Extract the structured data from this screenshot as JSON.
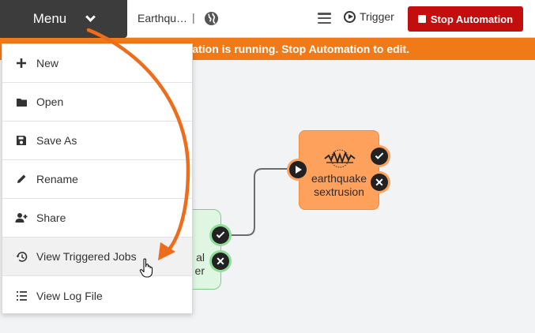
{
  "topbar": {
    "menu_label": "Menu",
    "doc_title": "Earthqu…",
    "separator": "|",
    "trigger_label": "Trigger",
    "stop_label": "Stop Automation"
  },
  "banner": {
    "text": "Automation is running. Stop Automation to edit."
  },
  "menu": {
    "items": [
      {
        "label": "New",
        "icon": "plus-icon"
      },
      {
        "label": "Open",
        "icon": "folder-icon"
      },
      {
        "label": "Save As",
        "icon": "floppy-disk-icon"
      },
      {
        "label": "Rename",
        "icon": "pencil-icon"
      },
      {
        "label": "Share",
        "icon": "user-plus-icon"
      },
      {
        "label": "View Triggered Jobs",
        "icon": "history-icon"
      },
      {
        "label": "View Log File",
        "icon": "list-icon"
      }
    ]
  },
  "canvas": {
    "node_orange_label": "earthquake sextrusion",
    "node_green_label_line1": "al",
    "node_green_label_line2": "er"
  },
  "colors": {
    "accent_orange": "#f07a17",
    "stop_red": "#c40d0d",
    "node_orange": "#fda15d",
    "node_green": "#dff7e2",
    "menu_dark": "#3c3c3c"
  }
}
